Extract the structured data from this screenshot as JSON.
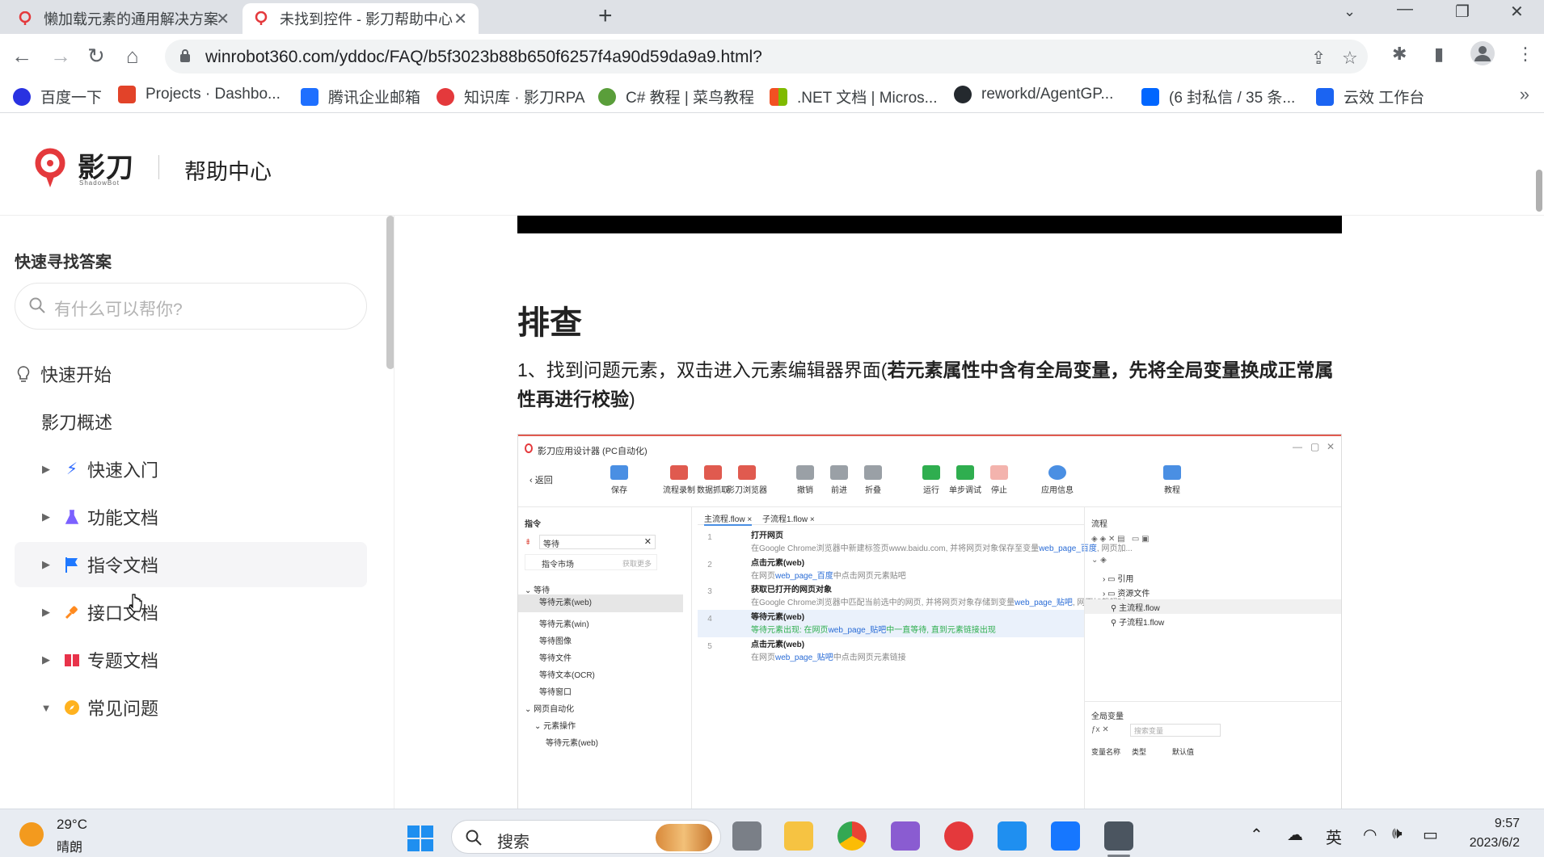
{
  "browser": {
    "tabs": [
      {
        "title": "懒加载元素的通用解决方案----B",
        "active": false
      },
      {
        "title": "未找到控件 - 影刀帮助中心",
        "active": true
      }
    ],
    "url": "winrobot360.com/yddoc/FAQ/b5f3023b88b650f6257f4a90d59da9a9.html?",
    "bookmarks": [
      {
        "label": "百度一下",
        "icon": "baidu-icon",
        "color": "#2932e1"
      },
      {
        "label": "Projects · Dashbo...",
        "icon": "gitlab-icon",
        "color": "#e24329"
      },
      {
        "label": "腾讯企业邮箱",
        "icon": "mail-icon",
        "color": "#1e6fff"
      },
      {
        "label": "知识库 · 影刀RPA",
        "icon": "shadowbot-icon",
        "color": "#e4393c"
      },
      {
        "label": "C# 教程 | 菜鸟教程",
        "icon": "runoob-icon",
        "color": "#5a9e3a"
      },
      {
        "label": ".NET 文档 | Micros...",
        "icon": "microsoft-icon",
        "color": "#f25022"
      },
      {
        "label": "reworkd/AgentGP...",
        "icon": "github-icon",
        "color": "#24292e"
      },
      {
        "label": "(6 封私信 / 35 条...",
        "icon": "zhihu-icon",
        "color": "#0066ff"
      },
      {
        "label": "云效 工作台",
        "icon": "yunxiao-icon",
        "color": "#1b64f2"
      }
    ]
  },
  "site": {
    "logo_text": "影刀",
    "logo_sub": "ShadowBot",
    "header_title": "帮助中心"
  },
  "sidebar": {
    "title": "快速寻找答案",
    "search_placeholder": "有什么可以帮你?",
    "quick_start": "快速开始",
    "overview": "影刀概述",
    "items": [
      {
        "label": "快速入门",
        "icon": "lightning-icon",
        "color": "#2f6bff",
        "expanded": false
      },
      {
        "label": "功能文档",
        "icon": "flask-icon",
        "color": "#7b61ff",
        "expanded": false
      },
      {
        "label": "指令文档",
        "icon": "flag-icon",
        "color": "#1f78ff",
        "expanded": false
      },
      {
        "label": "接口文档",
        "icon": "plug-icon",
        "color": "#ff8a1f",
        "expanded": false
      },
      {
        "label": "专题文档",
        "icon": "book-icon",
        "color": "#e8334a",
        "expanded": false
      },
      {
        "label": "常见问题",
        "icon": "compass-icon",
        "color": "#ffb21f",
        "expanded": true
      }
    ]
  },
  "article": {
    "section_title": "排查",
    "step1_plain": "1、找到问题元素，双击进入元素编辑器界面(",
    "step1_bold": "若元素属性中含有全局变量，先将全局变量换成正常属性再进行校验",
    "step1_end": ")"
  },
  "screenshot": {
    "app_title": "影刀应用设计器 (PC自动化)",
    "back": "返回",
    "ribbon": [
      "保存",
      "流程录制",
      "数据抓取",
      "影刀浏览器",
      "撤销",
      "前进",
      "折叠",
      "运行",
      "单步调试",
      "停止",
      "应用信息",
      "教程"
    ],
    "left_header": "指令",
    "left_search": "等待",
    "left_market": "指令市场",
    "left_more": "获取更多",
    "left_rows": [
      "等待",
      "等待元素(web)",
      "等待元素(win)",
      "等待图像",
      "等待文件",
      "等待文本(OCR)",
      "等待窗口",
      "网页自动化",
      "元素操作",
      "等待元素(web)"
    ],
    "tabs": [
      "主流程.flow",
      "子流程1.flow"
    ],
    "code": [
      {
        "n": "1",
        "cmd": "打开网页",
        "pre": "在Google Chrome浏览器中新建标签页www.baidu.com, 并将网页对象保存至变量",
        "var": "web_page_百度",
        "post": ", 网页加..."
      },
      {
        "n": "2",
        "cmd": "点击元素(web)",
        "pre": "在网页",
        "var": "web_page_百度",
        "post": "中点击网页元素贴吧"
      },
      {
        "n": "3",
        "cmd": "获取已打开的网页对象",
        "pre": "在Google Chrome浏览器中匹配当前选中的网页, 并将网页对象存储到变量",
        "var": "web_page_贴吧",
        "post": ", 网页加载超时..."
      },
      {
        "n": "4",
        "cmd": "等待元素(web)",
        "pre": "等待元素出现: 在网页",
        "var": "web_page_贴吧",
        "post": "中一直等待, 直到元素链接出现"
      },
      {
        "n": "5",
        "cmd": "点击元素(web)",
        "pre": "在网页",
        "var": "web_page_贴吧",
        "post": "中点击网页元素链接"
      }
    ],
    "right_header": "流程",
    "right_rows": [
      "引用",
      "资源文件",
      "主流程.flow",
      "子流程1.flow"
    ],
    "globals_header": "全局变量",
    "globals_search": "搜索变量",
    "globals_cols": [
      "变量名称",
      "类型",
      "默认值"
    ]
  },
  "taskbar": {
    "temp": "29°C",
    "weather": "晴朗",
    "search": "搜索",
    "ime": "英",
    "time": "9:57",
    "date": "2023/6/2"
  },
  "colors": {
    "brand_red": "#e4393c",
    "link_blue": "#2a6cd6"
  }
}
